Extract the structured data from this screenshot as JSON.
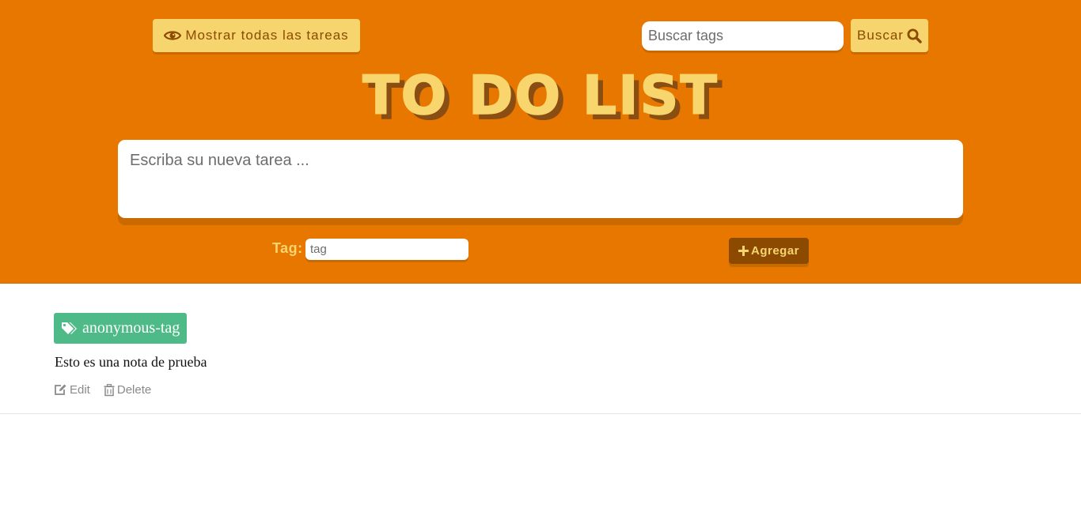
{
  "header": {
    "show_all_label": "Mostrar todas las tareas",
    "search_placeholder": "Buscar tags",
    "search_label": "Buscar",
    "title": "TO DO LIST",
    "task_placeholder": "Escriba su nueva tarea ...",
    "tag_label": "Tag:",
    "tag_placeholder": "tag",
    "add_label": "Agregar"
  },
  "notes": [
    {
      "tag": "anonymous-tag",
      "text": "Esto es una nota de prueba",
      "edit_label": "Edit",
      "delete_label": "Delete"
    }
  ],
  "icons": {
    "show_all": "eye-icon",
    "search": "search-icon",
    "add": "plus-icon",
    "tag": "tags-icon",
    "edit": "edit-icon",
    "delete": "trash-icon"
  },
  "colors": {
    "header_bg": "#e87700",
    "accent_yellow": "#f7d56e",
    "dark_brown": "#8c4a00",
    "tag_green": "#4dba87"
  }
}
